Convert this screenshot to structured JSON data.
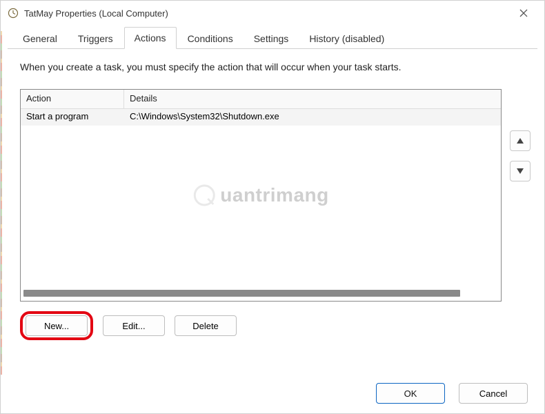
{
  "titlebar": {
    "title": "TatMay Properties (Local Computer)"
  },
  "tabs": {
    "general": "General",
    "triggers": "Triggers",
    "actions": "Actions",
    "conditions": "Conditions",
    "settings": "Settings",
    "history": "History (disabled)",
    "active": "actions"
  },
  "content": {
    "instruction": "When you create a task, you must specify the action that will occur when your task starts."
  },
  "list": {
    "headers": {
      "action": "Action",
      "details": "Details"
    },
    "rows": [
      {
        "action": "Start a program",
        "details": "C:\\Windows\\System32\\Shutdown.exe"
      }
    ]
  },
  "buttons": {
    "new": "New...",
    "edit": "Edit...",
    "delete": "Delete",
    "ok": "OK",
    "cancel": "Cancel"
  },
  "watermark": {
    "text": "uantrimang"
  }
}
